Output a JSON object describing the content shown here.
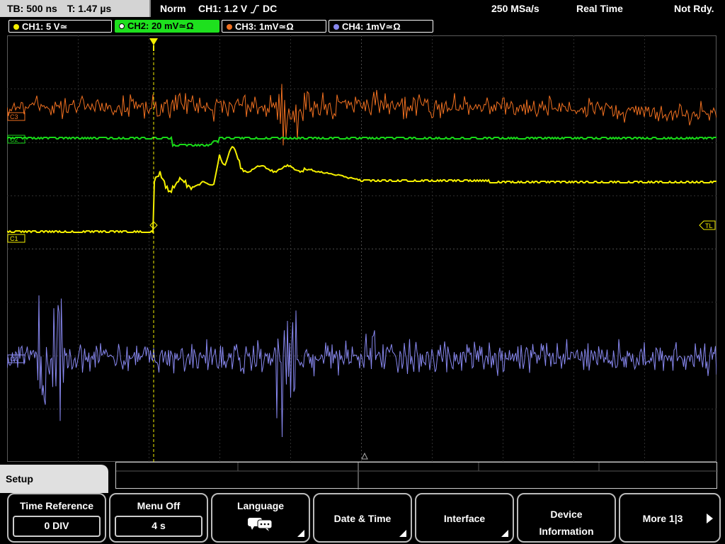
{
  "status": {
    "timebase": "TB: 500 ns",
    "trigger_time": "T: 1.47 µs",
    "mode": "Norm",
    "trigger_info": "CH1: 1.2 V",
    "trigger_slope": "⫆",
    "trigger_coupling": "DC",
    "sample_rate": "250 MSa/s",
    "acq_mode": "Real Time",
    "state": "Not Rdy."
  },
  "channels": [
    {
      "label": "CH1: 5 V≃",
      "color": "#f5f000"
    },
    {
      "label": "CH2: 20 mV≃Ω",
      "color": "#18d818"
    },
    {
      "label": "CH3: 1mV≃Ω",
      "color": "#f07020"
    },
    {
      "label": "CH4: 1mV≃Ω",
      "color": "#8888f0"
    }
  ],
  "markers": {
    "c1": "C1",
    "c2": "C2",
    "c3": "C3",
    "c4": "C4",
    "trigger_level": "TL"
  },
  "menu": {
    "title": "Setup",
    "time_reference": {
      "label": "Time Reference",
      "value": "0 DIV"
    },
    "menu_off": {
      "label": "Menu Off",
      "value": "4 s"
    },
    "language": {
      "label": "Language"
    },
    "date_time": {
      "label": "Date & Time"
    },
    "interface": {
      "label": "Interface"
    },
    "device_info": {
      "label_line1": "Device",
      "label_line2": "Information"
    },
    "more": {
      "label": "More 1|3"
    }
  },
  "icons": {
    "language": "speech-bubbles-icon",
    "more": "arrow-right-icon",
    "trigger": "trigger-position-icon"
  }
}
